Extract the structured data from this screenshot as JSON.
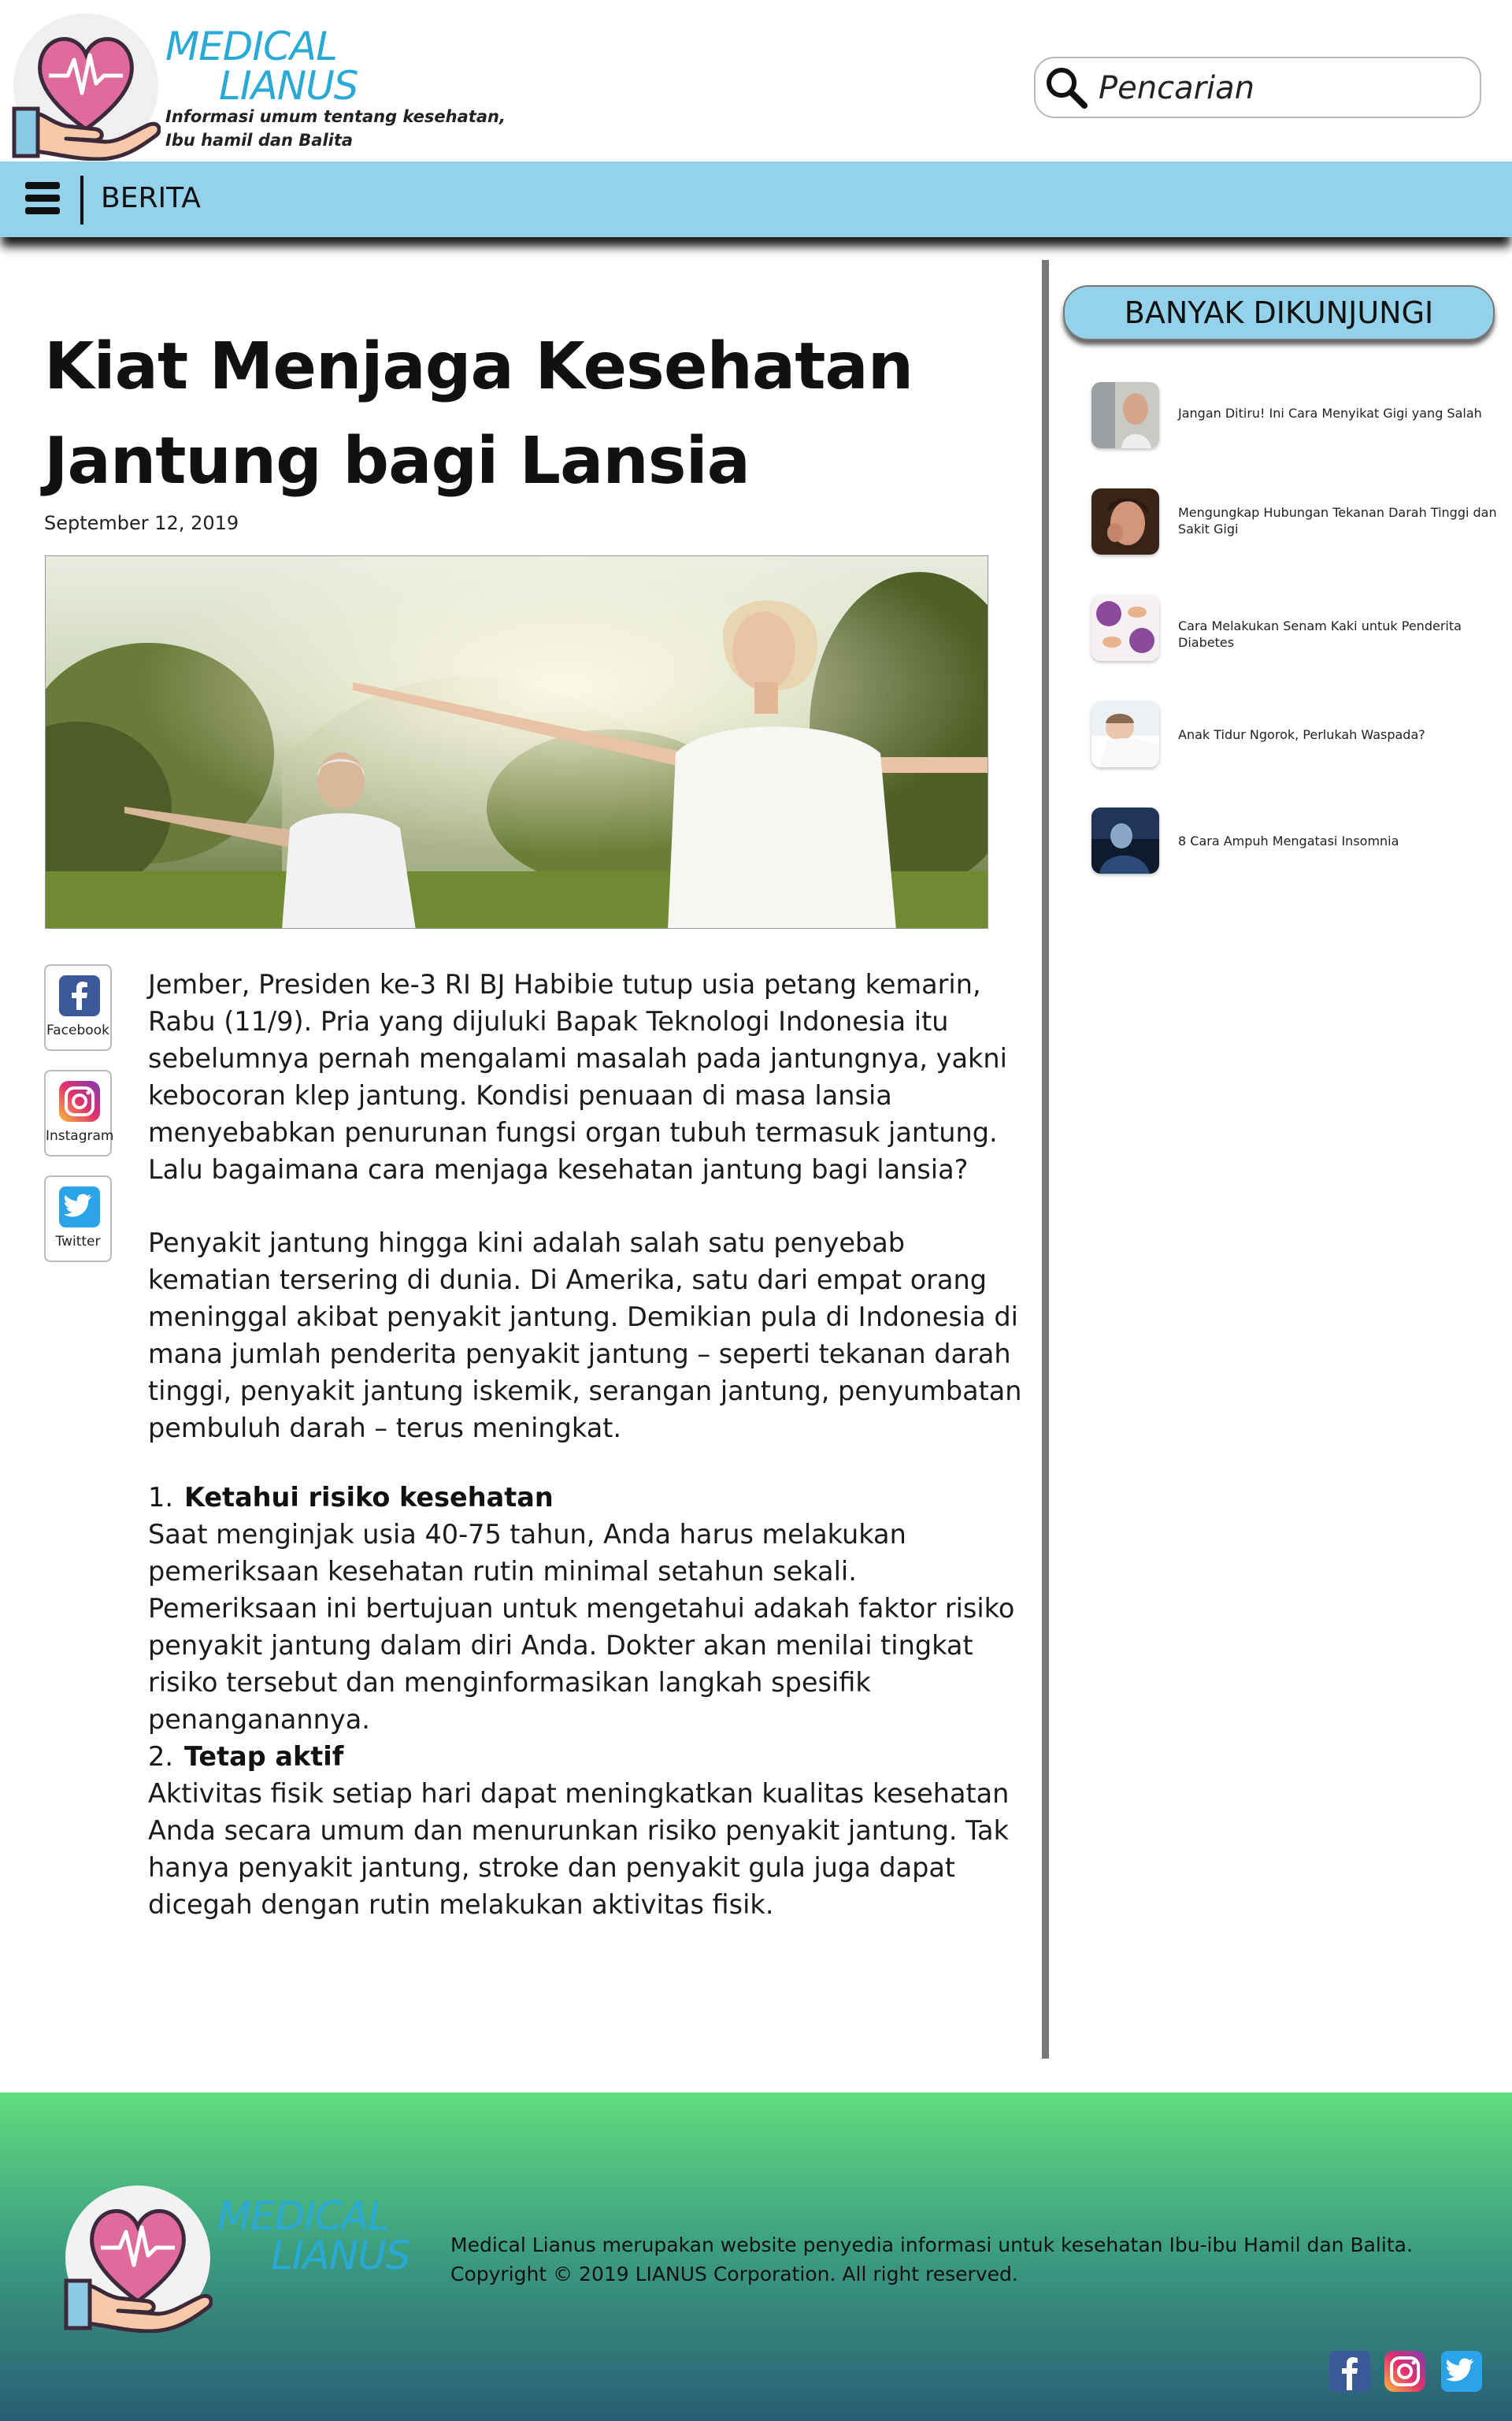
{
  "brand": {
    "name_line1": "MEDICAL",
    "name_line2": "LIANUS",
    "tagline_line1": "Informasi umum tentang kesehatan,",
    "tagline_line2": "Ibu hamil dan Balita",
    "accent_color": "#29a9d6",
    "heart_color": "#e06a9c"
  },
  "search": {
    "placeholder": "Pencarian",
    "icon": "search-icon"
  },
  "nav": {
    "menu_icon": "hamburger-icon",
    "label": "BERITA",
    "color": "#93d2ea"
  },
  "article": {
    "title_line1": "Kiat Menjaga Kesehatan",
    "title_line2": "Jantung bagi Lansia",
    "date": "September 12, 2019",
    "paragraph1": "Jember, Presiden ke-3 RI BJ Habibie tutup usia petang kemarin, Rabu (11/9). Pria yang dijuluki Bapak Teknologi Indonesia itu sebelumnya pernah mengalami masalah pada jantungnya, yakni kebocoran klep jantung. Kondisi penuaan di masa lansia menyebabkan penurunan fungsi organ tubuh termasuk jantung. Lalu bagaimana cara menjaga kesehatan jantung bagi lansia?",
    "paragraph2": "Penyakit jantung hingga kini adalah salah satu penyebab kematian tersering di dunia. Di Amerika, satu dari empat orang meninggal akibat penyakit jantung. Demikian pula di Indonesia di mana jumlah penderita penyakit jantung – seperti tekanan darah tinggi, penyakit jantung iskemik, serangan jantung, penyumbatan pembuluh darah – terus meningkat.",
    "sections": [
      {
        "number": "1.",
        "heading": "Ketahui risiko kesehatan",
        "text": "Saat menginjak usia 40-75 tahun, Anda harus melakukan pemeriksaan kesehatan rutin minimal setahun sekali. Pemeriksaan ini bertujuan untuk mengetahui adakah faktor risiko penyakit jantung dalam diri Anda. Dokter akan menilai tingkat risiko tersebut dan menginformasikan langkah spesifik penanganannya."
      },
      {
        "number": "2.",
        "heading": "Tetap aktif",
        "text": "Aktivitas fisik setiap hari dapat meningkatkan kualitas kesehatan Anda secara umum dan menurunkan risiko penyakit jantung. Tak hanya penyakit jantung, stroke dan penyakit gula juga dapat dicegah dengan rutin melakukan aktivitas fisik."
      }
    ]
  },
  "share": [
    {
      "label": "Facebook",
      "icon": "facebook-icon",
      "color": "#3b5998"
    },
    {
      "label": "Instagram",
      "icon": "instagram-icon",
      "color": "#c13584"
    },
    {
      "label": "Twitter",
      "icon": "twitter-icon",
      "color": "#2aa3e8"
    }
  ],
  "sidebar": {
    "heading": "BANYAK DIKUNJUNGI",
    "items": [
      {
        "title": "Jangan Ditiru! Ini Cara Menyikat Gigi yang Salah"
      },
      {
        "title": "Mengungkap Hubungan Tekanan Darah Tinggi dan Sakit Gigi"
      },
      {
        "title": "Cara Melakukan Senam Kaki untuk Penderita Diabetes"
      },
      {
        "title": "Anak Tidur Ngorok, Perlukah Waspada?"
      },
      {
        "title": "8 Cara Ampuh Mengatasi Insomnia"
      }
    ]
  },
  "footer": {
    "name_line1": "MEDICAL",
    "name_line2": "LIANUS",
    "description": "Medical Lianus merupakan website penyedia informasi untuk kesehatan Ibu-ibu Hamil dan Balita.",
    "copyright": "Copyright © 2019 LIANUS Corporation. All right reserved.",
    "social": [
      "facebook-icon",
      "instagram-icon",
      "twitter-icon"
    ]
  }
}
